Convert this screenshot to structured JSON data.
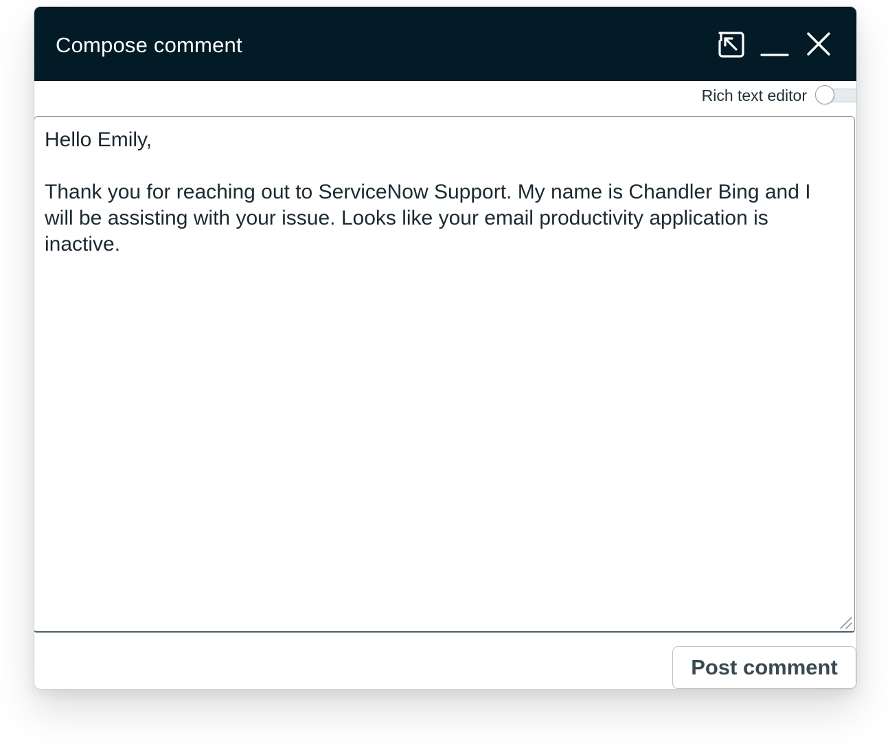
{
  "dialog": {
    "title": "Compose comment",
    "header_icons": [
      "popout-icon",
      "minimize-icon",
      "close-icon"
    ],
    "header_color": "#031b26"
  },
  "rich_text_editor": {
    "label": "Rich text editor",
    "enabled": false
  },
  "editor": {
    "value": "Hello Emily,\n\nThank you for reaching out to ServiceNow Support. My name is Chandler Bing and I will be assisting with your issue. Looks like your email productivity application is inactive."
  },
  "footer": {
    "post_label": "Post comment"
  }
}
